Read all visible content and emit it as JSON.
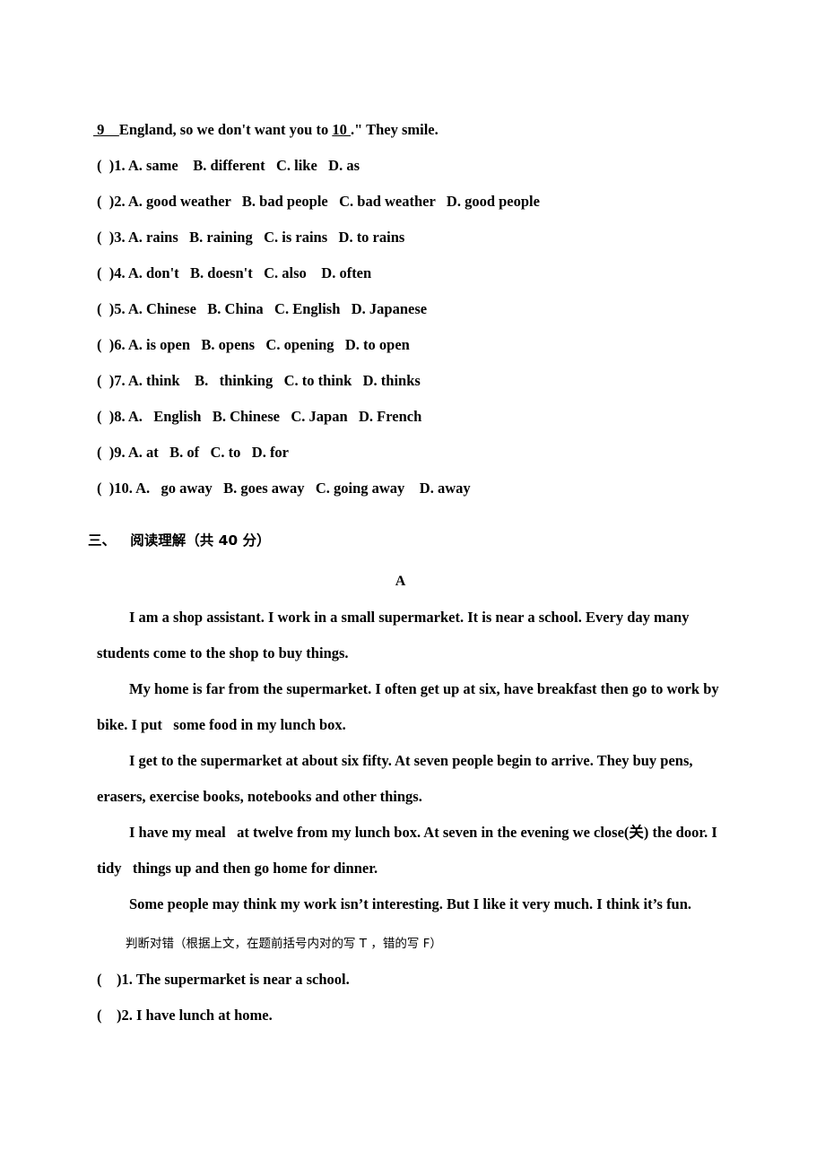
{
  "cloze": {
    "lead_line": {
      "blank_a": " 9    ",
      "text_mid": "England, so we don't want you to ",
      "blank_b": "10 ",
      "text_end": ".\" They smile."
    },
    "options": [
      "(  )1. A. same    B. different   C. like   D. as",
      "(  )2. A. good weather   B. bad people   C. bad weather   D. good people",
      "(  )3. A. rains   B. raining   C. is rains   D. to rains",
      "(  )4. A. don't   B. doesn't   C. also    D. often",
      "(  )5. A. Chinese   B. China   C. English   D. Japanese",
      "(  )6. A. is open   B. opens   C. opening   D. to open",
      "(  )7. A. think    B.   thinking   C. to think   D. thinks",
      "(  )8. A.   English   B. Chinese   C. Japan   D. French",
      "(  )9. A. at   B. of   C. to   D. for",
      "(  )10. A.   go away   B. goes away   C. going away    D. away"
    ]
  },
  "section": {
    "heading": "三、   阅读理解（共 40 分）",
    "passage_label": "A"
  },
  "passage": {
    "paragraphs": [
      "I am a shop assistant. I work in a small supermarket. It is near a school. Every day many students come to the shop to buy things.",
      "My home is far from the supermarket. I often get up at six, have breakfast then go to work by bike. I put   some food in my lunch box.",
      "I get to the supermarket at about six fifty. At seven people begin to arrive. They buy pens, erasers, exercise books, notebooks and other things.",
      "I have my meal   at twelve from my lunch box. At seven in the evening we close(关) the door. I tidy   things up and then go home for dinner.",
      "Some people may think my work isn’t interesting. But I like it very much. I think it’s fun."
    ]
  },
  "true_false": {
    "instruction": "判断对错（根据上文，在题前括号内对的写 T ，错的写 F）",
    "items": [
      "(    )1. The supermarket is near a school.",
      "(    )2. I have lunch at home."
    ]
  }
}
